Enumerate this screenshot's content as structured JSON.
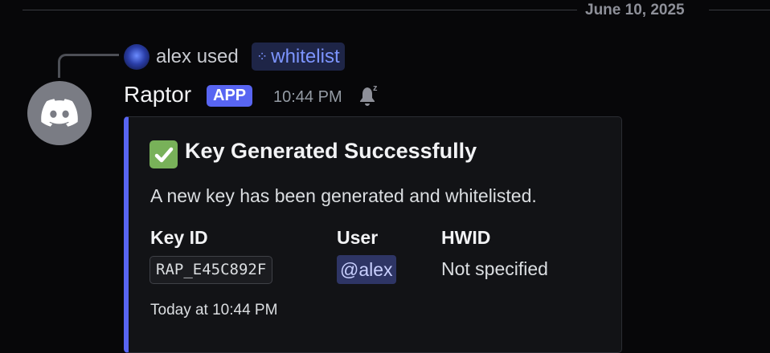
{
  "divider": {
    "date": "June 10, 2025"
  },
  "reply": {
    "user": "alex",
    "action": "used",
    "command": "whitelist"
  },
  "message": {
    "author": "Raptor",
    "badge": "APP",
    "timestamp": "10:44 PM"
  },
  "embed": {
    "accent_color": "#5865f2",
    "title": "Key Generated Successfully",
    "description": "A new key has been generated and whitelisted.",
    "fields": [
      {
        "name": "Key ID",
        "value": "RAP_E45C892F"
      },
      {
        "name": "User",
        "value": "@alex"
      },
      {
        "name": "HWID",
        "value": "Not specified"
      }
    ],
    "footer": "Today at 10:44 PM"
  },
  "icons": {
    "reply_avatar": "user-avatar",
    "command": "slash-command-icon",
    "bot_avatar": "discord-logo",
    "silent": "bell-snooze-icon",
    "title_check": "check-mark-icon"
  }
}
